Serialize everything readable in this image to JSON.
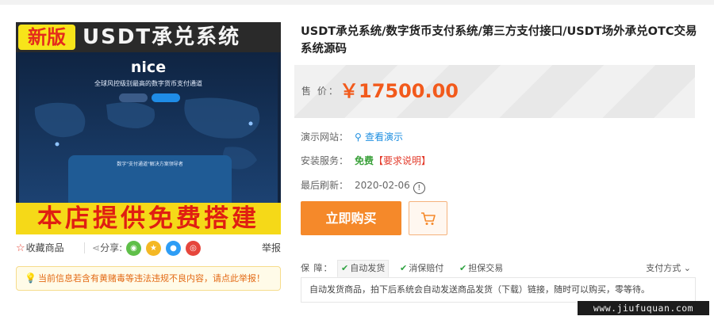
{
  "product_image": {
    "new_badge": "新版",
    "banner_title": "USDT承兑系统",
    "screen_brand": "nice",
    "screen_slogan": "全球风控级别最高的数字货币支付通道",
    "screen_button_1": "",
    "screen_button_2": "",
    "screen_card_text": "数字\"支付通道\"解决方案领导者",
    "bottom_banner": "本店提供免费搭建"
  },
  "actions": {
    "favorite_label": "收藏商品",
    "share_label": "分享:",
    "share_icons": [
      "wechat-icon",
      "qzone-icon",
      "qq-icon",
      "weibo-icon"
    ],
    "report_label": "举报"
  },
  "notice": {
    "text": "当前信息若含有黄赌毒等违法违规不良内容，请点此举报！"
  },
  "product": {
    "title": "USDT承兑系统/数字货币支付系统/第三方支付接口/USDT场外承兑OTC交易系统源码",
    "price_label": "售 价：",
    "price": "￥17500.00",
    "demo_label": "演示网站：",
    "demo_link": "查看演示",
    "install_label": "安装服务：",
    "install_value": "免费",
    "install_note": "【要求说明】",
    "refresh_label": "最后刷新：",
    "refresh_date": "2020-02-06",
    "buy_button": "立即购买"
  },
  "guarantee": {
    "label": "保 障：",
    "items": [
      "自动发货",
      "消保赔付",
      "担保交易"
    ],
    "pay_method": "支付方式",
    "description": "自动发货商品，拍下后系统会自动发送商品发货（下载）链接，随时可以购买，零等待。"
  },
  "watermark": "www.jiufuquan.com",
  "colors": {
    "price": "#f25a1c",
    "buy_button": "#f5892a",
    "link": "#1f8fe0",
    "free": "#3aa03a",
    "note": "#e33b2b"
  }
}
